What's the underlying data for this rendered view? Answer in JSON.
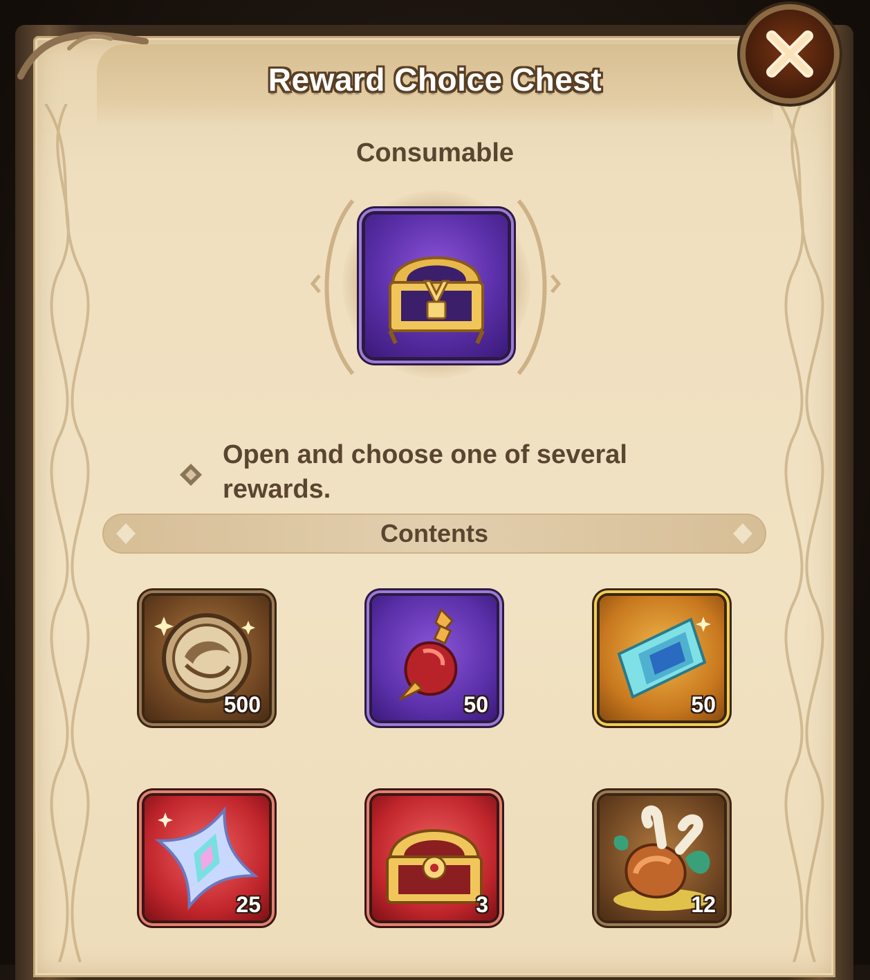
{
  "dialog": {
    "title": "Reward Choice Chest",
    "category": "Consumable",
    "description": "Open and choose one of several rewards.",
    "contents_label": "Contents",
    "close_icon": "close-icon",
    "main_item_icon": "treasure-chest-icon"
  },
  "items": [
    {
      "name": "coin-medallion",
      "icon": "bronze-medallion-icon",
      "quantity": "500",
      "rarity_color": "#6a4220"
    },
    {
      "name": "potion",
      "icon": "red-potion-icon",
      "quantity": "50",
      "rarity_color": "#5a2fa8"
    },
    {
      "name": "crystal",
      "icon": "diamond-crystal-icon",
      "quantity": "50",
      "rarity_color": "#c8781e"
    },
    {
      "name": "star-shard",
      "icon": "prismatic-star-icon",
      "quantity": "25",
      "rarity_color": "#c0262c"
    },
    {
      "name": "red-chest",
      "icon": "red-chest-icon",
      "quantity": "3",
      "rarity_color": "#c0262c"
    },
    {
      "name": "food",
      "icon": "roasted-meat-icon",
      "quantity": "12",
      "rarity_color": "#6a4220"
    }
  ]
}
